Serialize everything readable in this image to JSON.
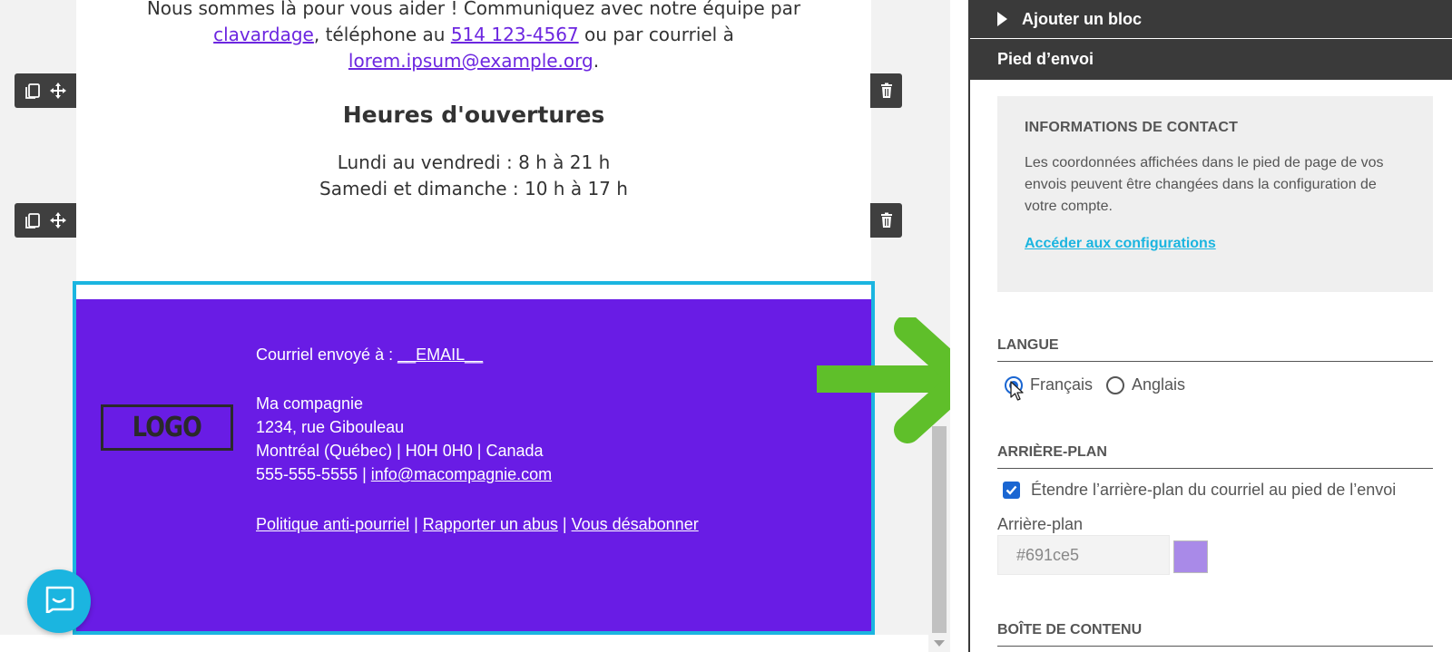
{
  "email": {
    "contact_line1": "Nous sommes là pour vous aider ! Communiquez avec notre équipe par",
    "chat_link": "clavardage",
    "phone_prefix": ", téléphone au ",
    "phone_link": "514 123-4567",
    "email_prefix": " ou par courriel à",
    "email_link": "lorem.ipsum@example.org",
    "email_suffix": ".",
    "hours_title": "Heures d'ouvertures",
    "hours_weekdays": "Lundi au vendredi : 8 h à 21 h",
    "hours_weekend": "Samedi et dimanche : 10 h à 17 h"
  },
  "footer": {
    "sent_to_label": "Courriel envoyé à : ",
    "sent_to_value": "__EMAIL__",
    "logo_text": "LOGO",
    "company": "Ma compagnie",
    "street": "1234, rue Gibouleau",
    "city": "Montréal (Québec) | H0H 0H0 | Canada",
    "phone": "555-555-5555 | ",
    "email": "info@macompagnie.com",
    "link_policy": "Politique anti-pourriel",
    "separator": " | ",
    "link_abuse": "Rapporter un abus",
    "link_unsub": "Vous désabonner",
    "background_color": "#691ce5"
  },
  "panel": {
    "add_block": "Ajouter un bloc",
    "footer_header": "Pied d’envoi",
    "contact_title": "INFORMATIONS DE CONTACT",
    "contact_desc": "Les coordonnées affichées dans le pied de page de vos envois peuvent être changées dans la configuration de votre compte.",
    "contact_link": "Accéder aux configurations",
    "language_title": "LANGUE",
    "lang_fr": "Français",
    "lang_en": "Anglais",
    "lang_selected": "Français",
    "background_title": "ARRIÈRE-PLAN",
    "extend_bg_label": "Étendre l’arrière-plan du courriel au pied de l’envoi",
    "extend_bg_checked": true,
    "bg_label": "Arrière-plan",
    "bg_value": "#691ce5",
    "bg_swatch_color": "#a98ae8",
    "content_box_title": "BOÎTE DE CONTENU"
  },
  "colors": {
    "accent": "#1bb5e0",
    "annotation_arrow": "#5fbf2a",
    "link_purple": "#6c26e0"
  },
  "icons": [
    "copy-icon",
    "move-icon",
    "trash-icon",
    "chat-icon",
    "cursor-icon",
    "arrow-right-icon"
  ]
}
